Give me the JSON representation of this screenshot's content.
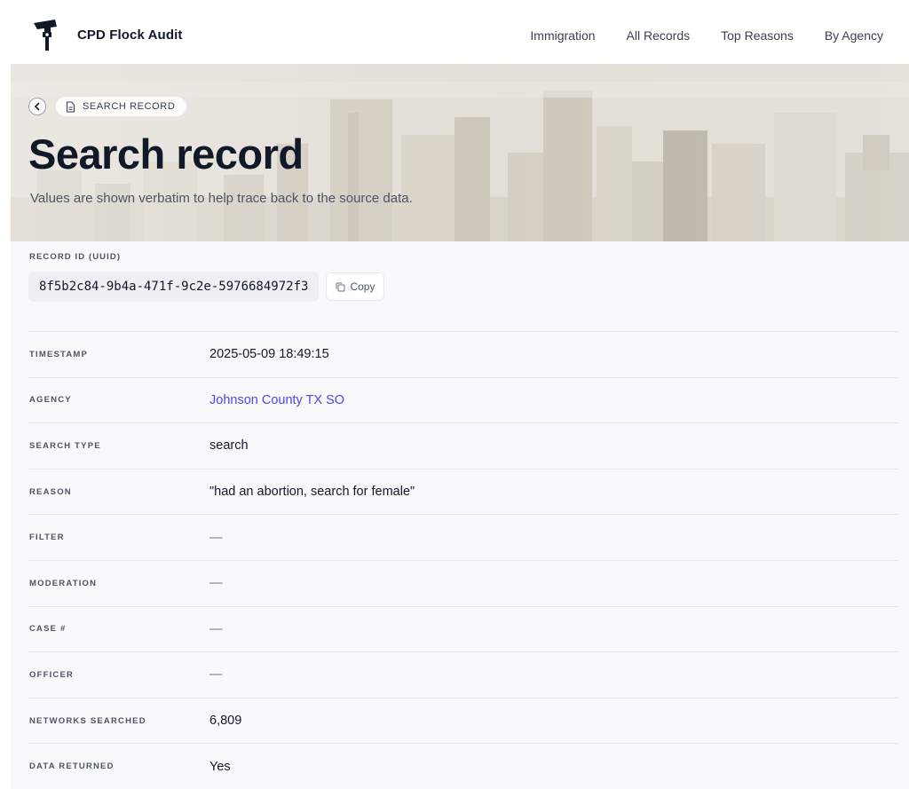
{
  "app": {
    "brand_name": "CPD Flock Audit",
    "logo_icon": "lamppost-camera-logo"
  },
  "nav": {
    "items": [
      {
        "label": "Immigration"
      },
      {
        "label": "All Records"
      },
      {
        "label": "Top Reasons"
      },
      {
        "label": "By Agency"
      }
    ]
  },
  "hero": {
    "breadcrumb_label": "SEARCH RECORD",
    "title": "Search record",
    "subtitle": "Values are shown verbatim to help trace back to the source data."
  },
  "record": {
    "uuid_label": "RECORD ID (UUID)",
    "uuid": "8f5b2c84-9b4a-471f-9c2e-5976684972f3",
    "copy_label": "Copy",
    "fields": [
      {
        "key": "TIMESTAMP",
        "value": "2025-05-09 18:49:15"
      },
      {
        "key": "AGENCY",
        "value": "Johnson County TX SO"
      },
      {
        "key": "SEARCH TYPE",
        "value": "search"
      },
      {
        "key": "REASON",
        "value": "\"had an abortion, search for female\""
      },
      {
        "key": "FILTER",
        "value": "—"
      },
      {
        "key": "MODERATION",
        "value": "—"
      },
      {
        "key": "CASE #",
        "value": "—"
      },
      {
        "key": "OFFICER",
        "value": "—"
      },
      {
        "key": "NETWORKS SEARCHED",
        "value": "6,809"
      },
      {
        "key": "DATA RETURNED",
        "value": "Yes"
      }
    ]
  },
  "colors": {
    "accent_link": "#4f46e5",
    "text_primary": "#111827",
    "text_muted": "#4b5563",
    "panel_bg": "#f8f9fb"
  }
}
